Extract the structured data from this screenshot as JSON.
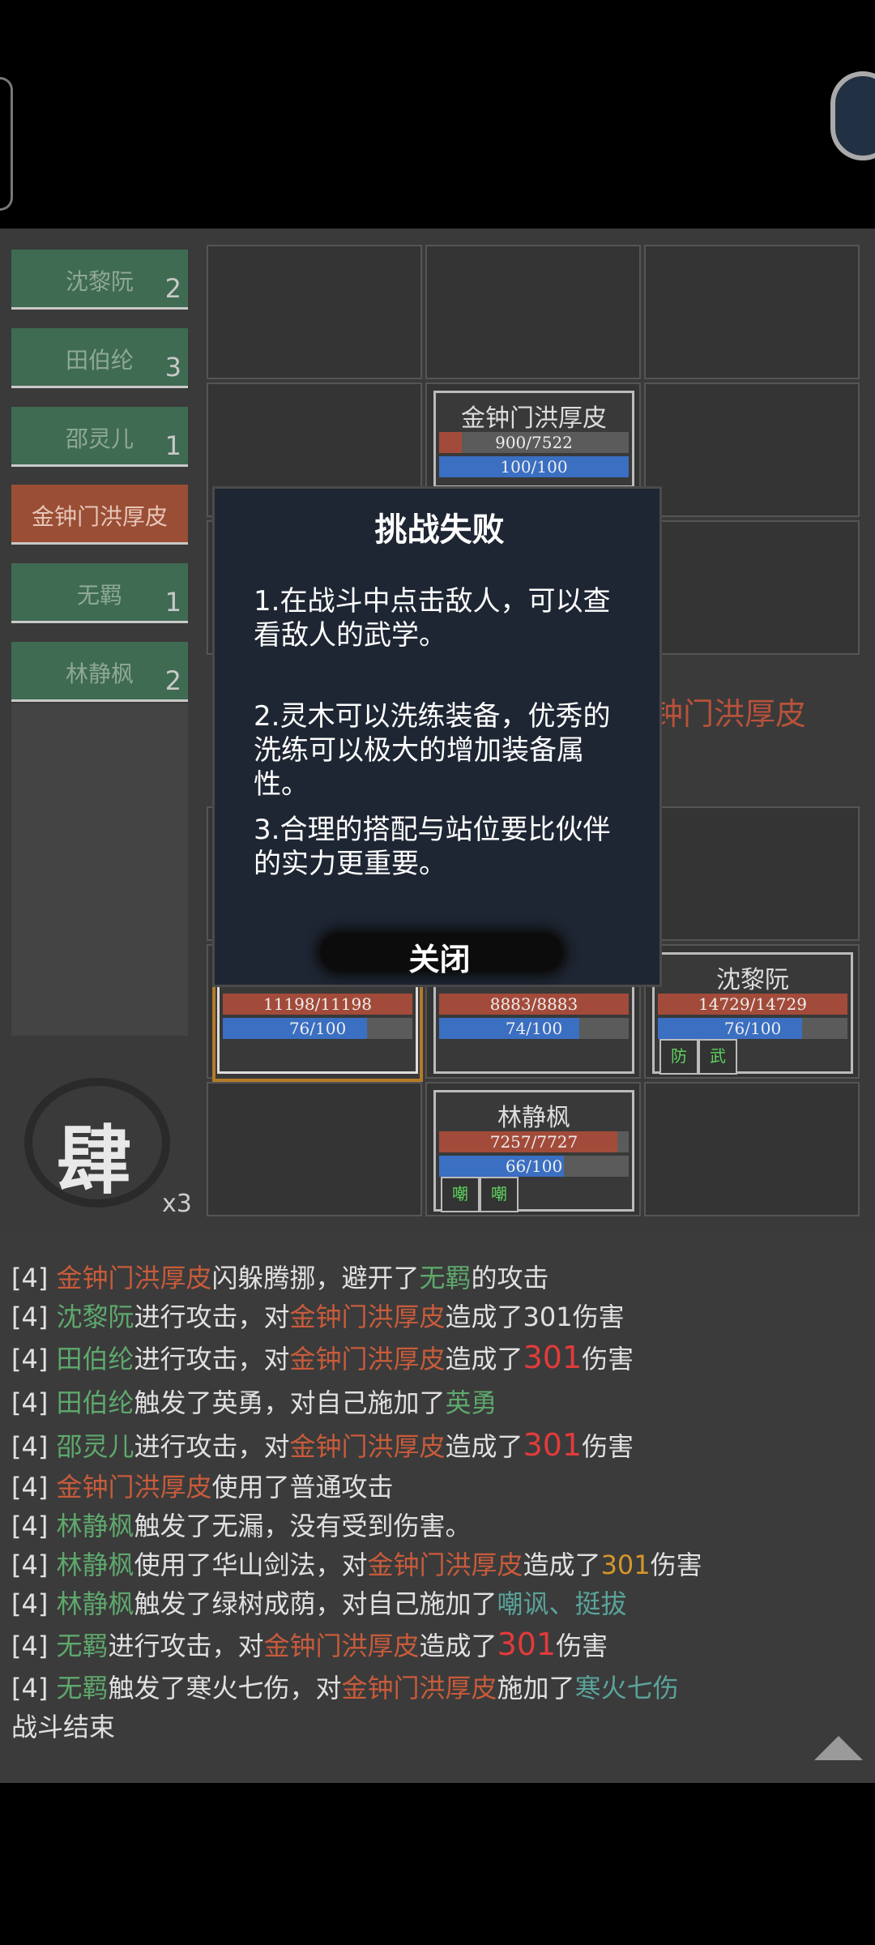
{
  "roster": [
    {
      "name": "沈黎阮",
      "count": "2"
    },
    {
      "name": "田伯纶",
      "count": "3"
    },
    {
      "name": "邵灵儿",
      "count": "1"
    },
    {
      "name": "金钟门洪厚皮",
      "count": ""
    },
    {
      "name": "无羁",
      "count": "1"
    },
    {
      "name": "林静枫",
      "count": "2"
    }
  ],
  "seal": {
    "char": "肆",
    "speed": "x3"
  },
  "enemy_card": {
    "name": "金钟门洪厚皮",
    "hp": "900/7522",
    "hp_ratio": 0.12,
    "mp": "100/100",
    "mp_ratio": 1.0
  },
  "enemy_label": "钟门洪厚皮",
  "ally_cards": [
    {
      "name": "",
      "hp": "11198/11198",
      "hp_ratio": 1.0,
      "mp": "76/100",
      "mp_ratio": 0.76
    },
    {
      "name": "",
      "hp": "8883/8883",
      "hp_ratio": 1.0,
      "mp": "74/100",
      "mp_ratio": 0.74
    },
    {
      "name": "沈黎阮",
      "hp": "14729/14729",
      "hp_ratio": 1.0,
      "mp": "76/100",
      "mp_ratio": 0.76,
      "skills": [
        "防",
        "武"
      ]
    },
    {
      "name": "林静枫",
      "hp": "7257/7727",
      "hp_ratio": 0.94,
      "mp": "66/100",
      "mp_ratio": 0.66,
      "skills": [
        "嘲",
        "嘲"
      ]
    }
  ],
  "dialog": {
    "title": "挑战失败",
    "tips": [
      "1.在战斗中点击敌人，可以查看敌人的武学。",
      "2.灵木可以洗练装备，优秀的洗练可以极大的增加装备属性。",
      "3.合理的搭配与站位要比伙伴的实力更重要。"
    ],
    "close": "关闭"
  },
  "log": {
    "l1": [
      "[4] ",
      "金钟门洪厚皮",
      "闪躲腾挪，避开了",
      "无羁",
      "的攻击"
    ],
    "l2": [
      "[4] ",
      "沈黎阮",
      "进行攻击，对",
      "金钟门洪厚皮",
      "造成了301伤害"
    ],
    "l3": [
      "[4] ",
      "田伯纶",
      "进行攻击，对",
      "金钟门洪厚皮",
      "造成了",
      "301",
      "伤害"
    ],
    "l4": [
      "[4] ",
      "田伯纶",
      "触发了英勇，对自己施加了",
      "英勇"
    ],
    "l5": [
      "[4] ",
      "邵灵儿",
      "进行攻击，对",
      "金钟门洪厚皮",
      "造成了",
      "301",
      "伤害"
    ],
    "l6": [
      "[4] ",
      "金钟门洪厚皮",
      "使用了普通攻击"
    ],
    "l7": [
      "[4] ",
      "林静枫",
      "触发了无漏，没有受到伤害。"
    ],
    "l8": [
      "[4] ",
      "林静枫",
      "使用了华山剑法，对",
      "金钟门洪厚皮",
      "造成了",
      "301",
      "伤害"
    ],
    "l9": [
      "[4] ",
      "林静枫",
      "触发了绿树成荫，对自己施加了",
      "嘲讽、挺拔"
    ],
    "l10": [
      "[4] ",
      "无羁",
      "进行攻击，对",
      "金钟门洪厚皮",
      "造成了",
      "301",
      "伤害"
    ],
    "l11": [
      "[4] ",
      "无羁",
      "触发了寒火七伤，对",
      "金钟门洪厚皮",
      "施加了",
      "寒火七伤"
    ],
    "end": "战斗结束"
  }
}
